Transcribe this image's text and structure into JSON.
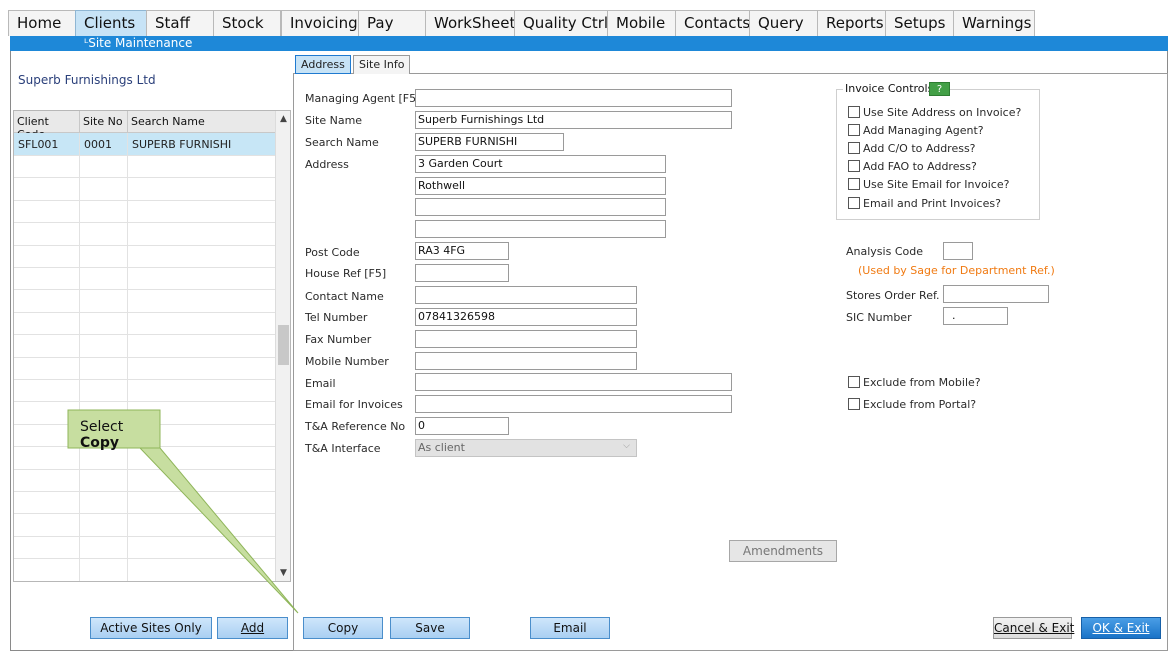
{
  "menu": {
    "tabs": [
      {
        "label": "Home"
      },
      {
        "label": "Clients",
        "active": true
      },
      {
        "label": "Staff"
      },
      {
        "label": "Stock"
      },
      {
        "label": "Invoicing"
      },
      {
        "label": "Pay"
      },
      {
        "label": "WorkSheet"
      },
      {
        "label": "Quality Ctrl"
      },
      {
        "label": "Mobile"
      },
      {
        "label": "Contacts"
      },
      {
        "label": "Query"
      },
      {
        "label": "Reports"
      },
      {
        "label": "Setups"
      },
      {
        "label": "Warnings"
      }
    ]
  },
  "breadcrumb": "ᴸSite Maintenance",
  "client": {
    "name": "Superb Furnishings Ltd"
  },
  "grid": {
    "columns": [
      "Client Code",
      "Site No",
      "Search Name"
    ],
    "rows": [
      {
        "client_code": "SFL001",
        "site_no": "0001",
        "search_name": "SUPERB FURNISHI"
      }
    ]
  },
  "left_buttons": {
    "active_sites": "Active Sites Only",
    "add": "Add"
  },
  "subtabs": {
    "address": "Address",
    "site_info": "Site Info"
  },
  "form": {
    "managing_agent": {
      "label": "Managing Agent [F5]",
      "value": ""
    },
    "site_name": {
      "label": "Site Name",
      "value": "Superb Furnishings Ltd"
    },
    "search_name": {
      "label": "Search Name",
      "value": "SUPERB FURNISHI"
    },
    "address": {
      "label": "Address",
      "line1": "3 Garden Court",
      "line2": "Rothwell",
      "line3": "",
      "line4": ""
    },
    "post_code": {
      "label": "Post Code",
      "value": "RA3 4FG"
    },
    "house_ref": {
      "label": "House Ref [F5]",
      "value": ""
    },
    "contact_name": {
      "label": "Contact Name",
      "value": ""
    },
    "tel_number": {
      "label": "Tel Number",
      "value": "07841326598"
    },
    "fax_number": {
      "label": "Fax Number",
      "value": ""
    },
    "mobile_number": {
      "label": "Mobile Number",
      "value": ""
    },
    "email": {
      "label": "Email",
      "value": ""
    },
    "email_invoices": {
      "label": "Email for Invoices",
      "value": ""
    },
    "ta_ref": {
      "label": "T&A Reference No",
      "value": "0"
    },
    "ta_interface": {
      "label": "T&A Interface",
      "value": "As client"
    }
  },
  "invoice_controls": {
    "title": "Invoice Controls",
    "help_icon": "help-icon",
    "help_text": "?",
    "options": [
      {
        "label": "Use Site Address on Invoice?",
        "checked": false
      },
      {
        "label": "Add Managing Agent?",
        "checked": false
      },
      {
        "label": "Add C/O to Address?",
        "checked": false
      },
      {
        "label": "Add FAO to Address?",
        "checked": false
      },
      {
        "label": "Use Site Email for Invoice?",
        "checked": false
      },
      {
        "label": "Email and Print Invoices?",
        "checked": false
      }
    ]
  },
  "analysis": {
    "analysis_code": {
      "label": "Analysis Code",
      "value": ""
    },
    "sage_note": "(Used by Sage for Department Ref.)",
    "stores_order": {
      "label": "Stores Order Ref.",
      "value": ""
    },
    "sic_number": {
      "label": "SIC Number",
      "value": "."
    }
  },
  "exclusions": [
    {
      "label": "Exclude from Mobile?",
      "checked": false
    },
    {
      "label": "Exclude from Portal?",
      "checked": false
    }
  ],
  "buttons": {
    "amendments": "Amendments",
    "copy": "Copy",
    "save": "Save",
    "email": "Email",
    "cancel_exit": "Cancel & Exit",
    "ok_exit": "OK & Exit"
  },
  "callout": {
    "prefix": "Select ",
    "emphasis": "Copy"
  },
  "colors": {
    "accent": "#1e88d8",
    "selected_row": "#c7e6f6",
    "callout_fill": "#c7dea0",
    "sage_note": "#f07a12"
  }
}
